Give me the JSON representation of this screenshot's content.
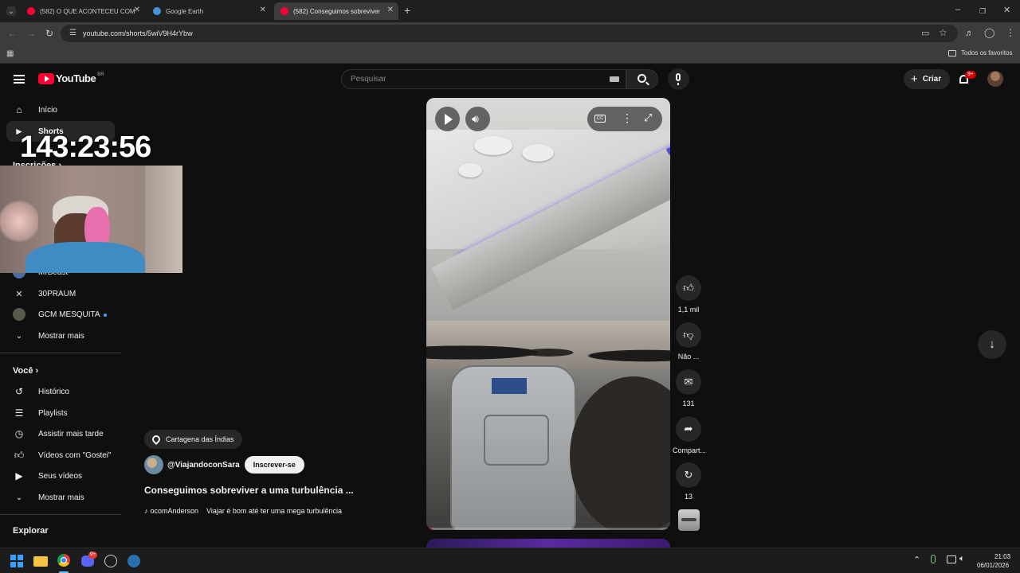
{
  "browser": {
    "tabs": [
      {
        "title": "(582) O QUE ACONTECEU COM",
        "favicon_color": "#ff0033"
      },
      {
        "title": "Google Earth",
        "favicon_color": "#4a90d9"
      },
      {
        "title": "(582) Conseguimos sobreviver",
        "favicon_color": "#ff0033"
      }
    ],
    "new_tab": "+",
    "url": "youtube.com/shorts/5wiV9H4rYbw",
    "bookmarks_folder": "Todos os favoritos"
  },
  "yt": {
    "logo_text": "YouTube",
    "logo_region": "BR",
    "search_placeholder": "Pesquisar",
    "create_label": "Criar",
    "notif_badge": "9+"
  },
  "sidebar": {
    "home": "Início",
    "shorts": "Shorts",
    "subs_head": "Inscrições",
    "subs": [
      {
        "name": "MrBeast"
      },
      {
        "name": "30PRAUM"
      },
      {
        "name": "GCM MESQUITA"
      }
    ],
    "show_more_1": "Mostrar mais",
    "you_head": "Você",
    "you_items": [
      {
        "label": "Histórico",
        "icon": "history-icon"
      },
      {
        "label": "Playlists",
        "icon": "playlist-icon"
      },
      {
        "label": "Assistir mais tarde",
        "icon": "clock-icon"
      },
      {
        "label": "Vídeos com \"Gostei\"",
        "icon": "like-icon"
      },
      {
        "label": "Seus vídeos",
        "icon": "video-icon"
      }
    ],
    "show_more_2": "Mostrar mais",
    "explore_head": "Explorar"
  },
  "overlay": {
    "timer": "143:23:56"
  },
  "short": {
    "location": "Cartagena das Índias",
    "channel": "@ViajandoconSara",
    "subscribe": "Inscrever-se",
    "title": "Conseguimos sobreviver a uma turbulência ...",
    "sound_author": "ocomAnderson",
    "sound_desc": "Viajar é bom até ter uma mega turbulência",
    "likes": "1,1 mil",
    "dislike_label": "Não ...",
    "comments": "131",
    "share_label": "Compart...",
    "remix_count": "13"
  },
  "taskbar": {
    "time": "21:03",
    "date": "06/01/2026",
    "discord_badge": "9+"
  }
}
